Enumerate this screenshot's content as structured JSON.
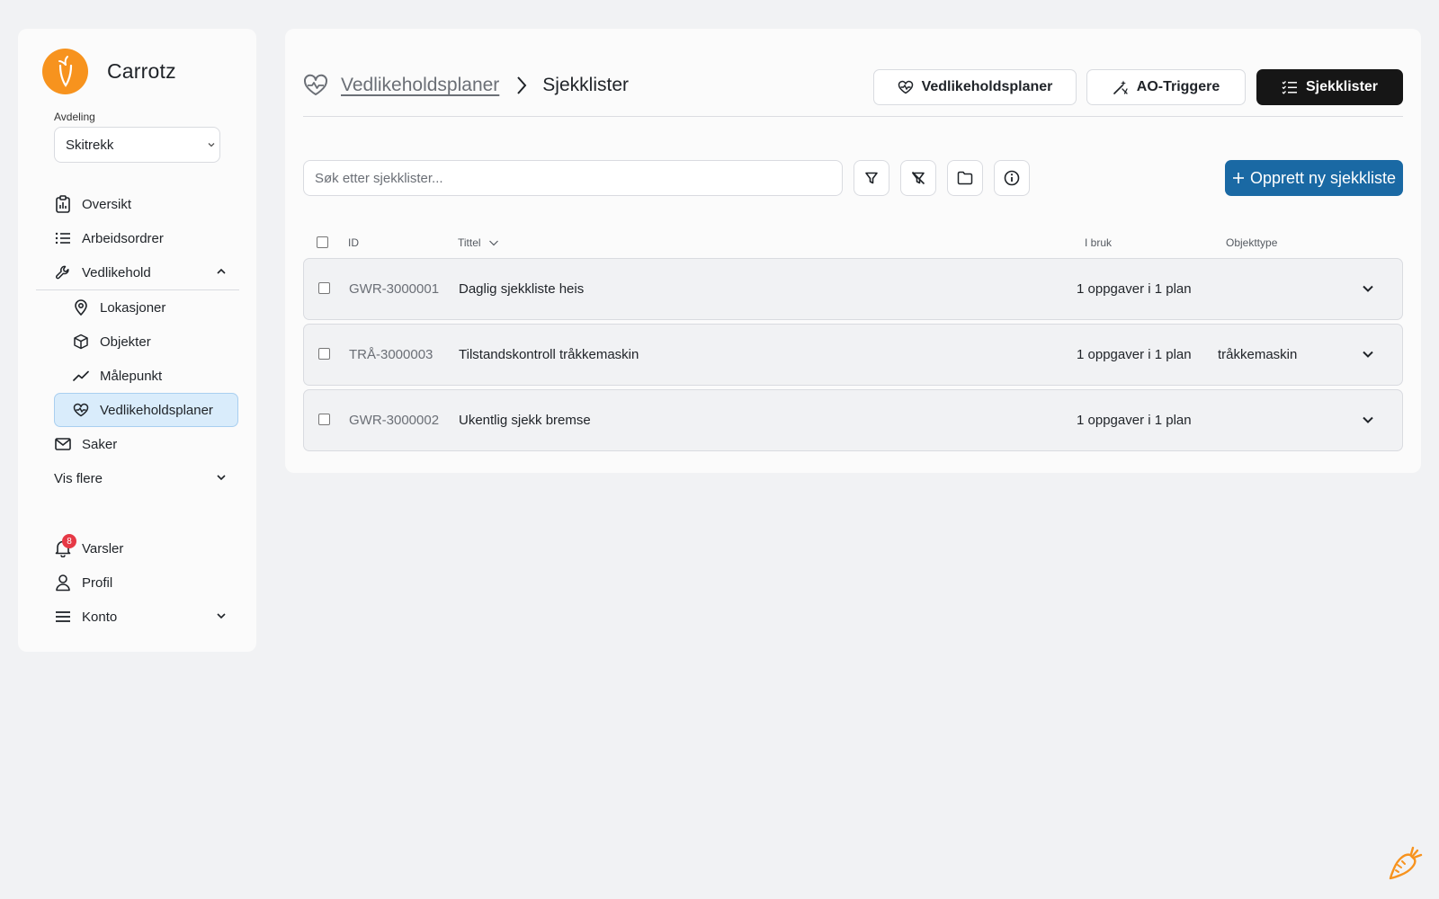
{
  "brand": {
    "name": "Carrotz",
    "accent": "#f7931e"
  },
  "department": {
    "label": "Avdeling",
    "value": "Skitrekk"
  },
  "sidebar": {
    "items": [
      {
        "label": "Oversikt",
        "icon": "clipboard-chart-icon"
      },
      {
        "label": "Arbeidsordrer",
        "icon": "list-icon"
      },
      {
        "label": "Vedlikehold",
        "icon": "wrench-icon",
        "expanded": true
      },
      {
        "label": "Lokasjoner",
        "icon": "map-pin-icon"
      },
      {
        "label": "Objekter",
        "icon": "cube-icon"
      },
      {
        "label": "Målepunkt",
        "icon": "trend-line-icon"
      },
      {
        "label": "Vedlikeholdsplaner",
        "icon": "heart-pulse-icon",
        "active": true
      },
      {
        "label": "Saker",
        "icon": "mail-icon"
      },
      {
        "label": "Vis flere",
        "icon": "chevron-down-icon"
      }
    ],
    "bottom": [
      {
        "label": "Varsler",
        "icon": "bell-icon",
        "badge": "8"
      },
      {
        "label": "Profil",
        "icon": "user-icon"
      },
      {
        "label": "Konto",
        "icon": "menu-icon"
      }
    ]
  },
  "breadcrumb": {
    "parent": "Vedlikeholdsplaner",
    "current": "Sjekklister"
  },
  "tabs": [
    {
      "label": "Vedlikeholdsplaner",
      "icon": "heart-pulse-icon"
    },
    {
      "label": "AO-Triggere",
      "icon": "wand-icon"
    },
    {
      "label": "Sjekklister",
      "icon": "checklist-icon",
      "selected": true
    }
  ],
  "search": {
    "placeholder": "Søk etter sjekklister..."
  },
  "toolbar": {
    "create_label": "Opprett ny sjekkliste",
    "create_color": "#1a69a4"
  },
  "table": {
    "columns": {
      "id": "ID",
      "title": "Tittel",
      "usage": "I bruk",
      "object_type": "Objekttype"
    },
    "rows": [
      {
        "id": "GWR-3000001",
        "title": "Daglig sjekkliste heis",
        "usage": "1 oppgaver i 1 plan",
        "object_type": ""
      },
      {
        "id": "TRÅ-3000003",
        "title": "Tilstandskontroll tråkkemaskin",
        "usage": "1 oppgaver i 1 plan",
        "object_type": "tråkkemaskin"
      },
      {
        "id": "GWR-3000002",
        "title": "Ukentlig sjekk bremse",
        "usage": "1 oppgaver i 1 plan",
        "object_type": ""
      }
    ]
  }
}
